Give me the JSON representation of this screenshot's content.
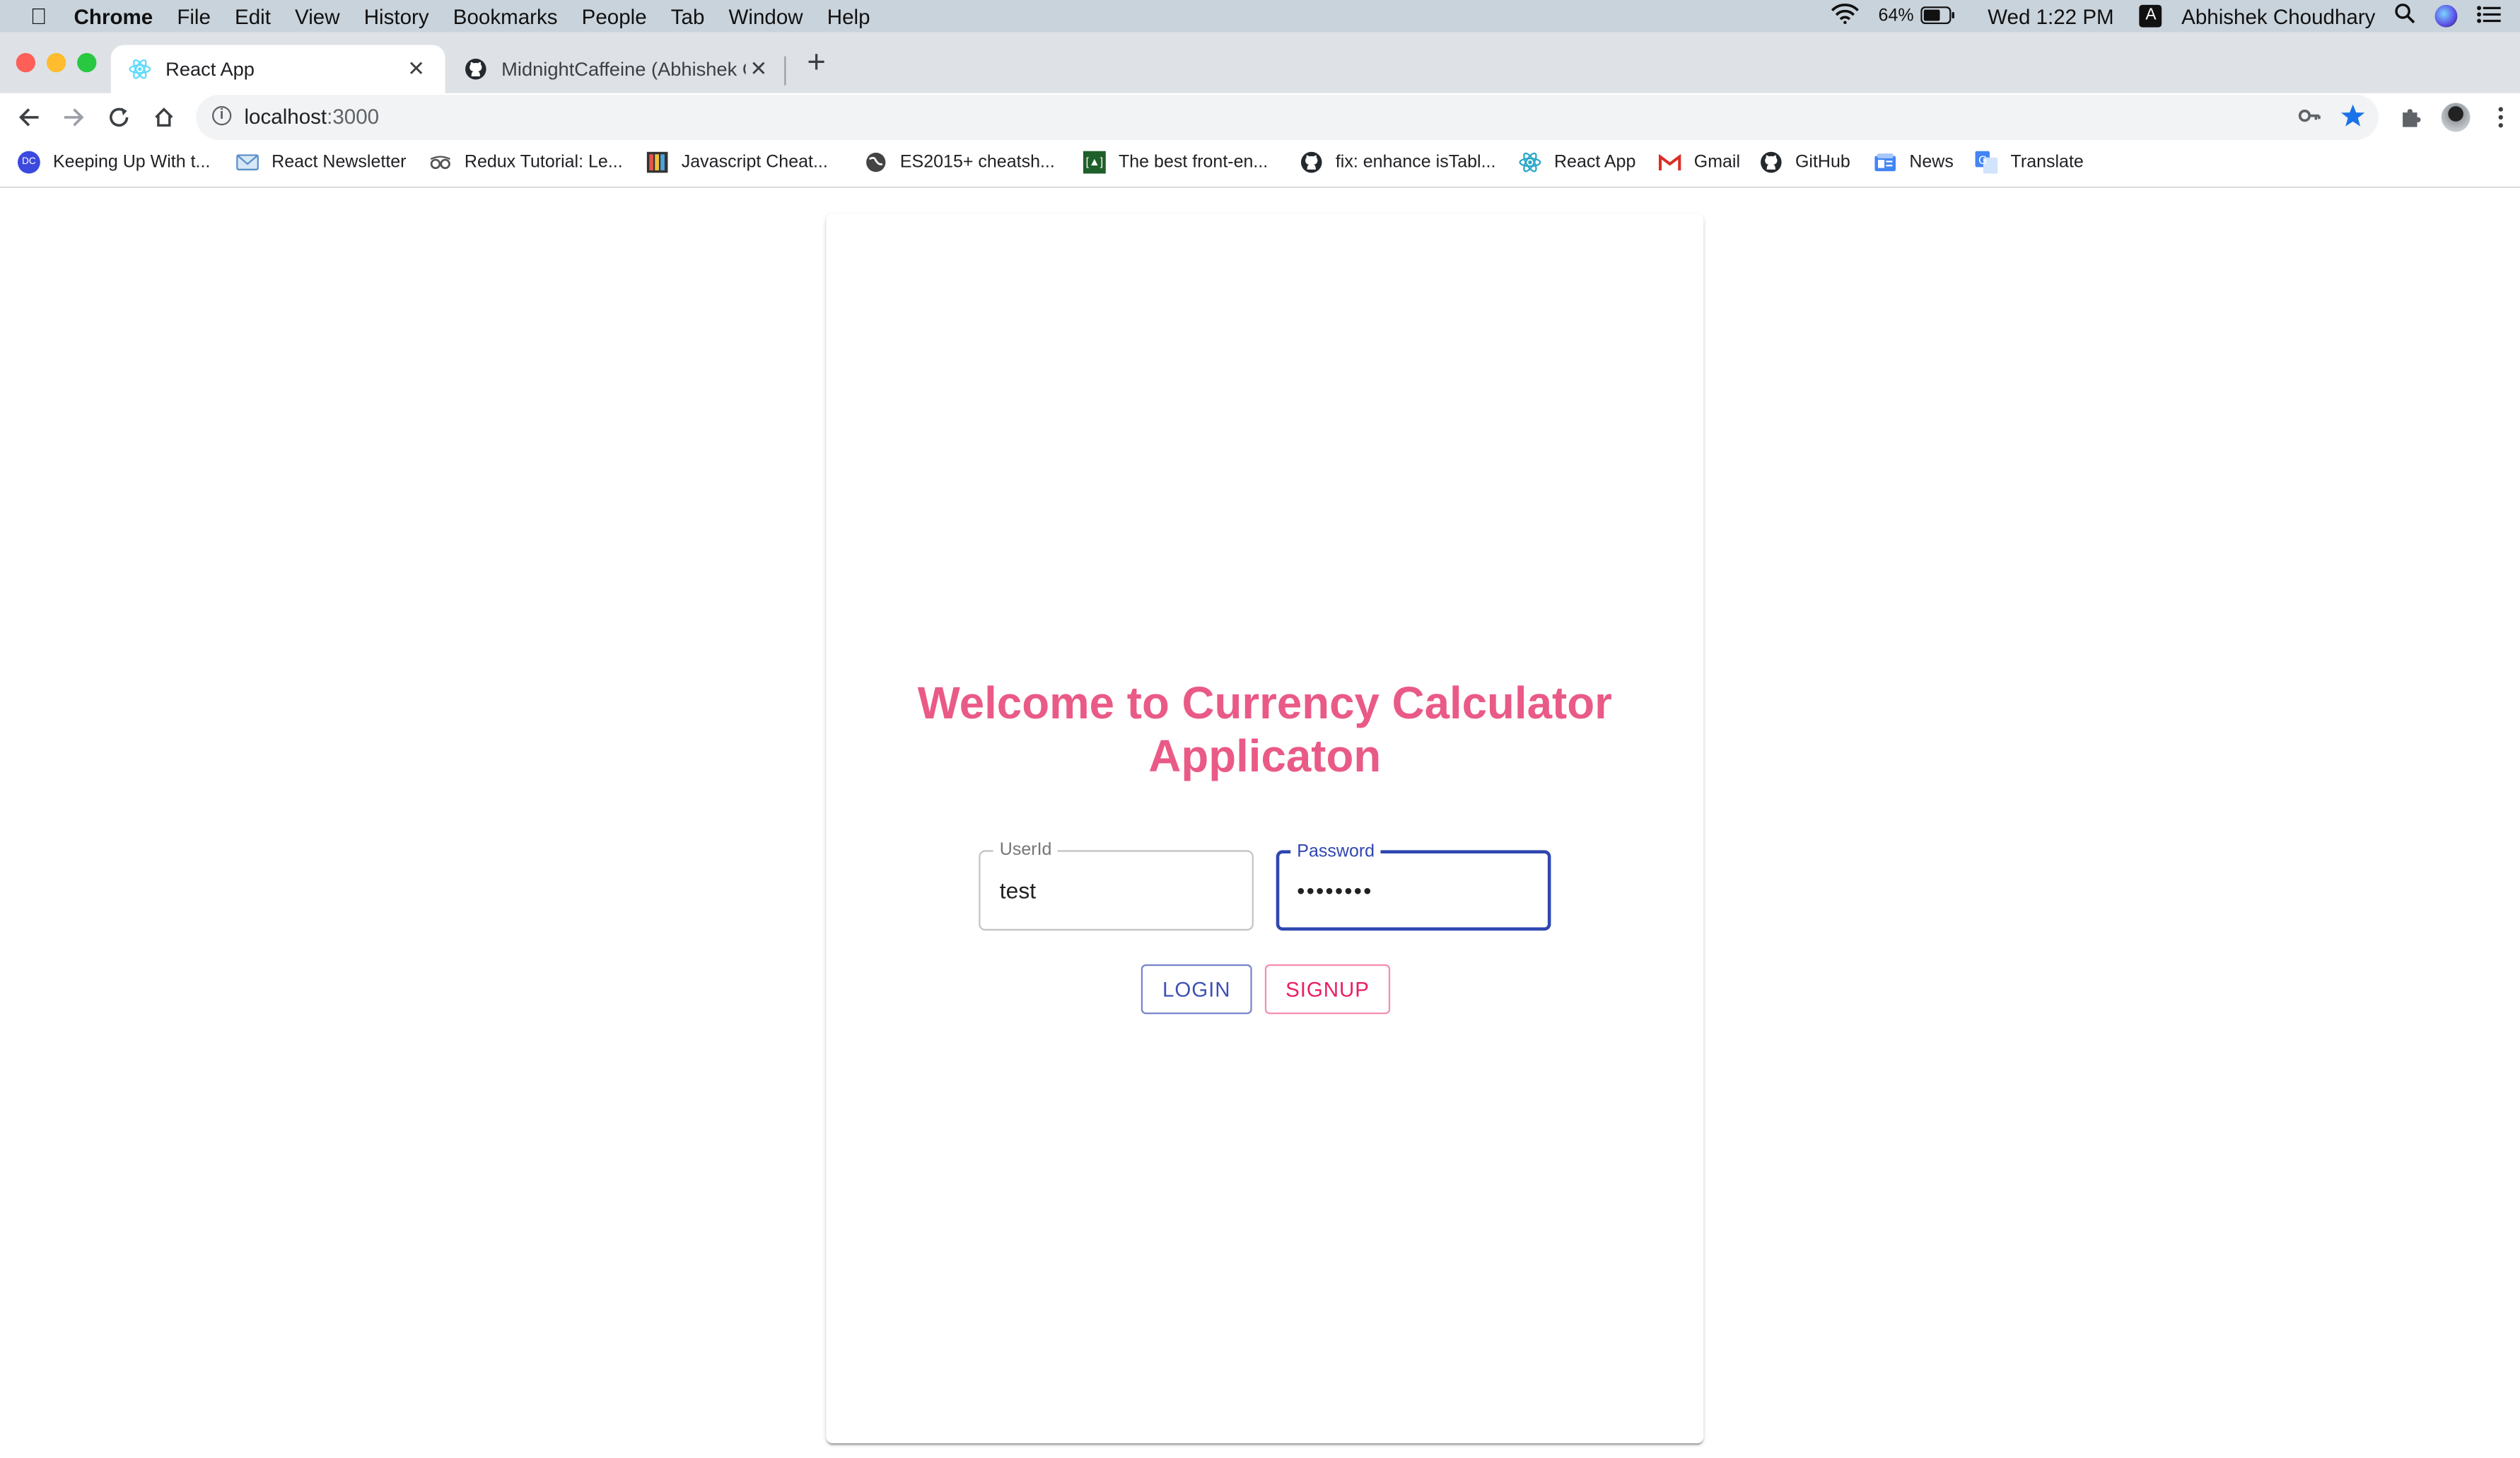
{
  "menubar": {
    "app": "Chrome",
    "items": [
      "File",
      "Edit",
      "View",
      "History",
      "Bookmarks",
      "People",
      "Tab",
      "Window",
      "Help"
    ],
    "battery": "64%",
    "clock": "Wed 1:22 PM",
    "input_source": "A",
    "user": "Abhishek Choudhary"
  },
  "tabs": [
    {
      "title": "React App",
      "active": true
    },
    {
      "title": "MidnightCaffeine (Abhishek Ch",
      "active": false
    }
  ],
  "address_bar": {
    "host": "localhost",
    "port": ":3000"
  },
  "bookmarks": [
    {
      "label": "Keeping Up With t...",
      "icon": "dev-community-icon"
    },
    {
      "label": "React Newsletter",
      "icon": "react-newsletter-icon"
    },
    {
      "label": "Redux Tutorial: Le...",
      "icon": "glasses-icon"
    },
    {
      "label": "Javascript Cheat...",
      "icon": "books-icon"
    },
    {
      "label": "ES2015+ cheatsh...",
      "icon": "globe-icon"
    },
    {
      "label": "The best front-en...",
      "icon": "frontend-icon"
    },
    {
      "label": "fix: enhance isTabl...",
      "icon": "github-icon"
    },
    {
      "label": "React App",
      "icon": "react-icon"
    },
    {
      "label": "Gmail",
      "icon": "gmail-icon"
    },
    {
      "label": "GitHub",
      "icon": "github-icon"
    },
    {
      "label": "News",
      "icon": "news-icon"
    },
    {
      "label": "Translate",
      "icon": "translate-icon"
    }
  ],
  "login": {
    "title_line1": "Welcome to Currency Calculator",
    "title_line2": "Applicaton",
    "userid_label": "UserId",
    "userid_value": "test",
    "password_label": "Password",
    "password_value": "••••••••",
    "login_button": "LOGIN",
    "signup_button": "SIGNUP"
  },
  "colors": {
    "title": "#ea5a86",
    "primary": "#3f51b5",
    "secondary": "#e91e63",
    "focus_border": "#2f47b0"
  }
}
